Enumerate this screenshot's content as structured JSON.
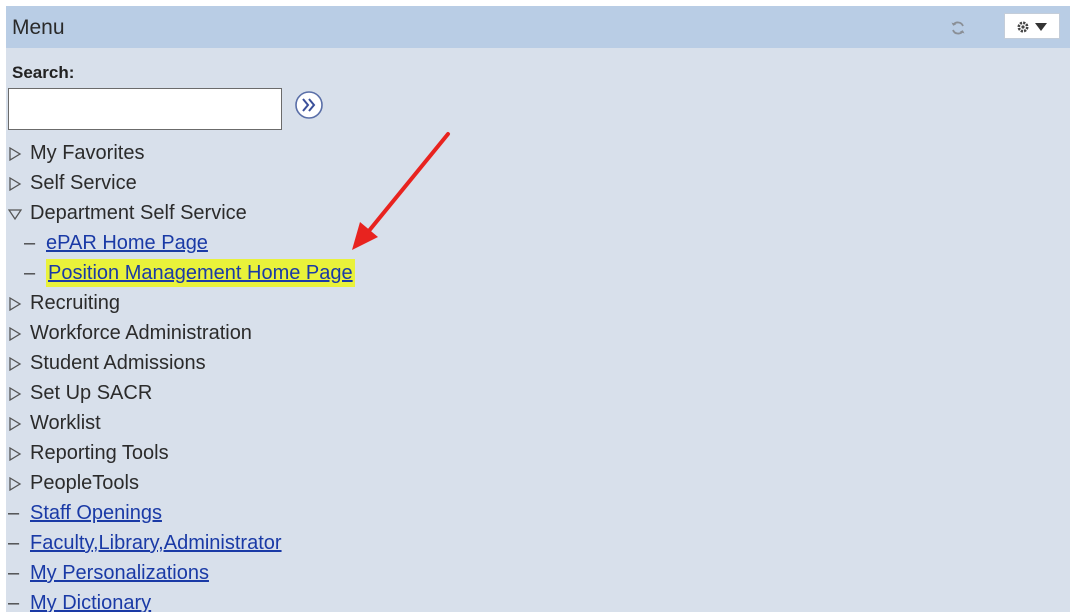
{
  "header": {
    "title": "Menu",
    "refresh_icon": "refresh-icon",
    "options_icon": "gear-dropdown-icon"
  },
  "search": {
    "label": "Search:",
    "value": "",
    "placeholder": "",
    "go_icon": "double-chevron-right-icon"
  },
  "menu": {
    "items": [
      {
        "label": "My Favorites",
        "kind": "folder",
        "state": "collapsed"
      },
      {
        "label": "Self Service",
        "kind": "folder",
        "state": "collapsed"
      },
      {
        "label": "Department Self Service",
        "kind": "folder",
        "state": "expanded"
      },
      {
        "label": "ePAR Home Page",
        "kind": "link",
        "level": "child"
      },
      {
        "label": "Position Management Home Page",
        "kind": "link",
        "level": "child",
        "highlighted": true
      },
      {
        "label": "Recruiting",
        "kind": "folder",
        "state": "collapsed"
      },
      {
        "label": "Workforce Administration",
        "kind": "folder",
        "state": "collapsed"
      },
      {
        "label": "Student Admissions",
        "kind": "folder",
        "state": "collapsed"
      },
      {
        "label": "Set Up SACR",
        "kind": "folder",
        "state": "collapsed"
      },
      {
        "label": "Worklist",
        "kind": "folder",
        "state": "collapsed"
      },
      {
        "label": "Reporting Tools",
        "kind": "folder",
        "state": "collapsed"
      },
      {
        "label": "PeopleTools",
        "kind": "folder",
        "state": "collapsed"
      },
      {
        "label": "Staff Openings",
        "kind": "link"
      },
      {
        "label": "Faculty,Library,Administrator",
        "kind": "link"
      },
      {
        "label": "My Personalizations",
        "kind": "link"
      },
      {
        "label": "My Dictionary",
        "kind": "link"
      }
    ]
  },
  "colors": {
    "panel_bg": "#d8e0eb",
    "header_bg": "#b9cde5",
    "link": "#1a3aa6",
    "highlight": "#e9f23a",
    "annotation_arrow": "#e8231f"
  }
}
